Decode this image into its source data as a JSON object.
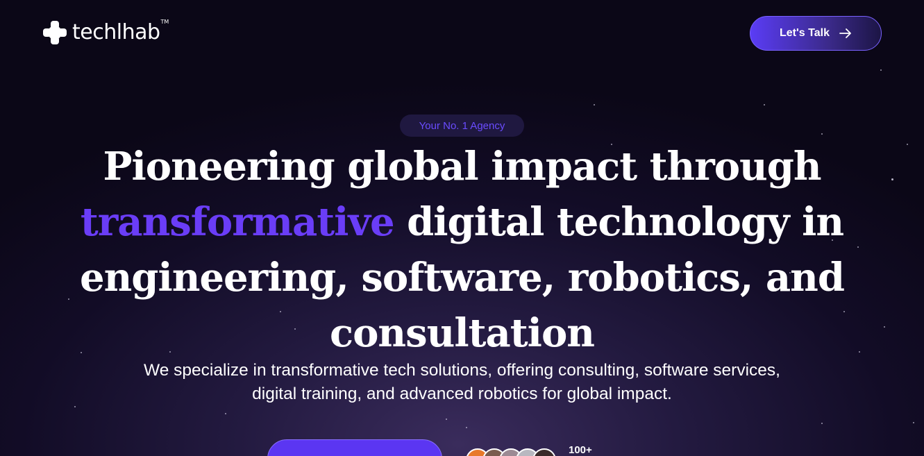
{
  "brand": {
    "name": "techlhab",
    "trademark": "TM"
  },
  "header": {
    "cta_label": "Let's Talk",
    "cta_icon": "arrow-right-icon"
  },
  "hero": {
    "badge": "Your No. 1 Agency",
    "headline_line1": "Pioneering global impact through",
    "headline_accent": "transformative",
    "headline_line2_rest": " digital technology in",
    "headline_line3": "engineering, software, robotics, and",
    "headline_line4": "consultation",
    "subtitle": "We specialize in transformative tech solutions, offering consulting, software services, digital training, and advanced robotics for global impact.",
    "primary_cta_label": "",
    "clients_count": "100+"
  },
  "colors": {
    "accent": "#6a3df7",
    "button": "#5b36f2",
    "background": "#0f0a20"
  },
  "avatars": [
    {
      "color": "#e8792a"
    },
    {
      "color": "#7a5c4e"
    },
    {
      "color": "#9c8a94"
    },
    {
      "color": "#b8b8c0"
    },
    {
      "color": "#3a2a2a"
    }
  ]
}
